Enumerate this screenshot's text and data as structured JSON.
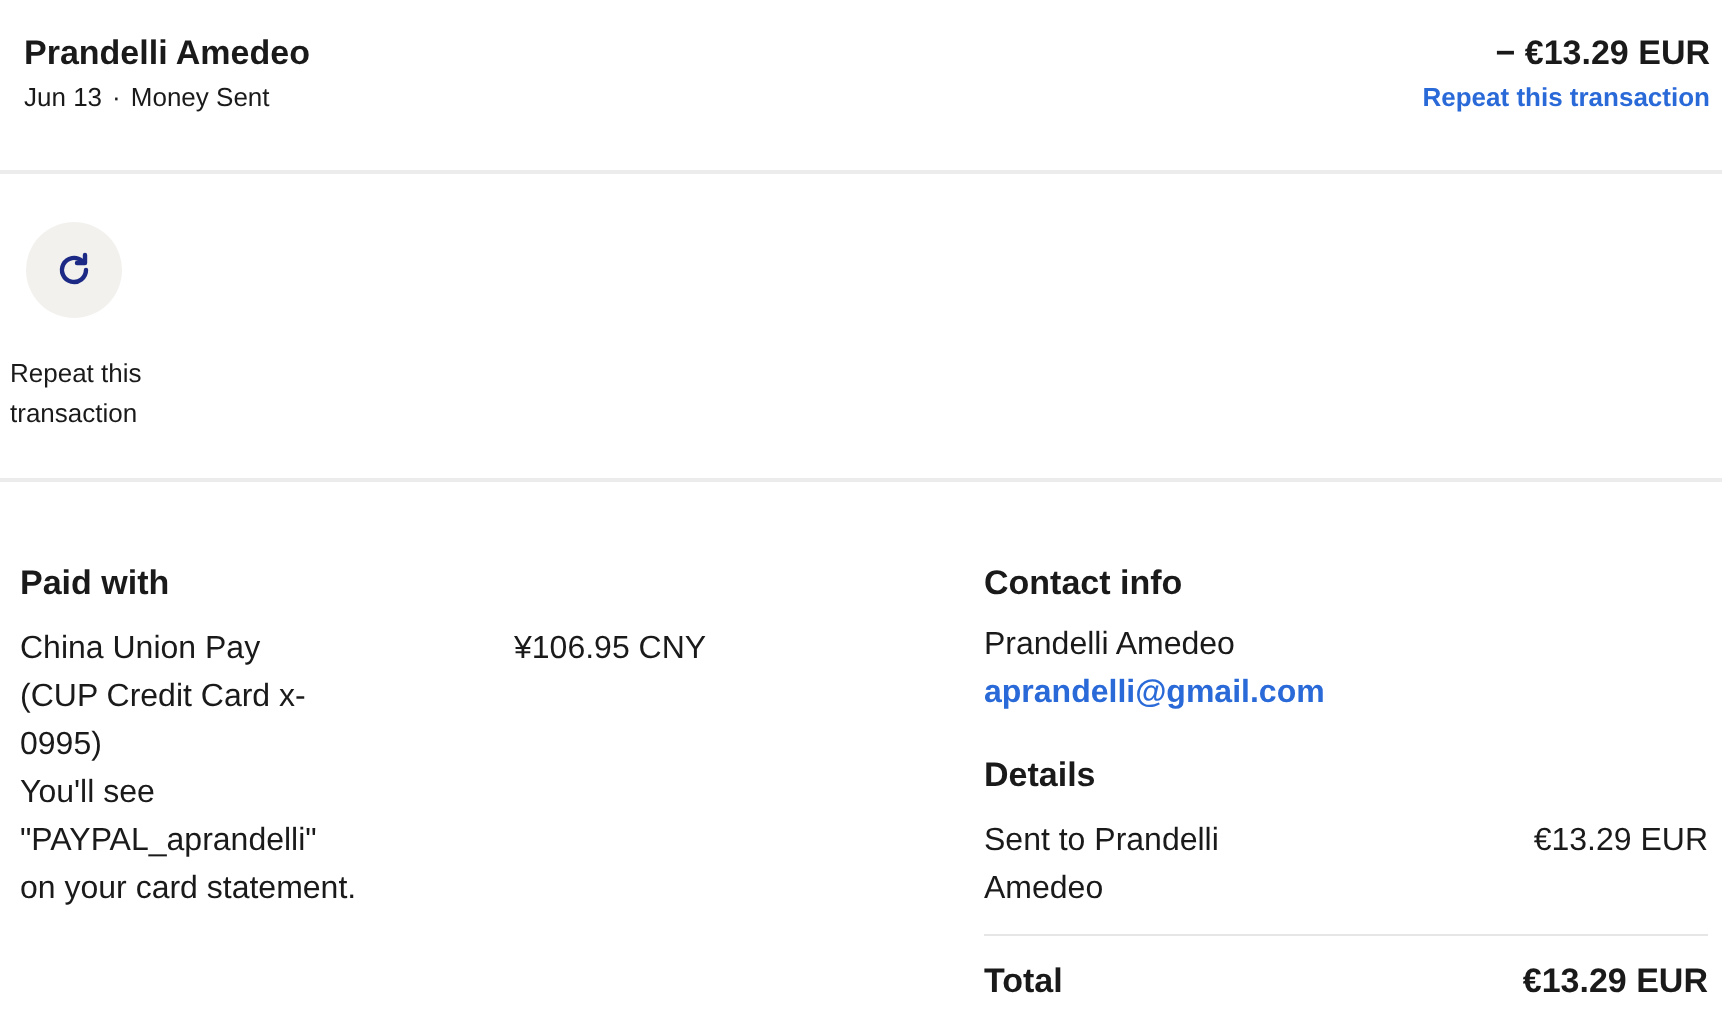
{
  "header": {
    "name": "Prandelli Amedeo",
    "date": "Jun 13",
    "separator": "·",
    "type": "Money Sent",
    "amount": "− €13.29 EUR",
    "repeat_link": "Repeat this transaction"
  },
  "actions": [
    {
      "label": "Repeat this transaction"
    }
  ],
  "paid_with": {
    "title": "Paid with",
    "method": "China Union Pay (CUP Credit Card x-0995)",
    "note": "You'll see \"PAYPAL_aprandelli\" on your card statement.",
    "amount": "¥106.95 CNY"
  },
  "contact_info": {
    "title": "Contact info",
    "name": "Prandelli Amedeo",
    "email": "aprandelli@gmail.com"
  },
  "details": {
    "title": "Details",
    "rows": [
      {
        "label": "Sent to Prandelli Amedeo",
        "amount": "€13.29 EUR"
      }
    ],
    "total": {
      "label": "Total",
      "amount": "€13.29 EUR"
    }
  }
}
